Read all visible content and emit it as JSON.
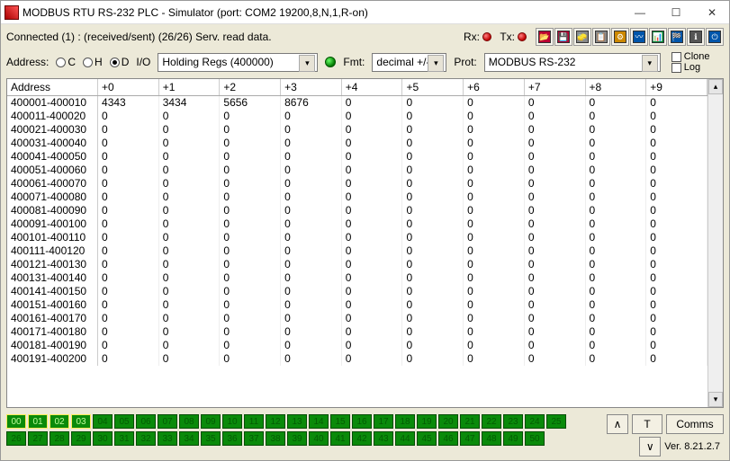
{
  "title": "MODBUS RTU RS-232 PLC - Simulator (port: COM2 19200,8,N,1,R-on)",
  "status": "Connected (1) : (received/sent) (26/26) Serv. read data.",
  "rx_label": "Rx:",
  "tx_label": "Tx:",
  "address_label": "Address:",
  "radio_c": "C",
  "radio_h": "H",
  "radio_d_checked": "D",
  "io_label": "I/O",
  "reg_sel": "Holding Regs (400000)",
  "fmt_label": "Fmt:",
  "fmt_sel": "decimal +/-",
  "prot_label": "Prot:",
  "prot_sel": "MODBUS RS-232",
  "clone_label": "Clone",
  "log_label": "Log",
  "icon_names": [
    "open",
    "save",
    "erase",
    "copy",
    "config",
    "wave",
    "chart",
    "flag",
    "about",
    "exit"
  ],
  "columns": [
    "Address",
    "+0",
    "+1",
    "+2",
    "+3",
    "+4",
    "+5",
    "+6",
    "+7",
    "+8",
    "+9"
  ],
  "rows": [
    {
      "addr": "400001-400010",
      "v": [
        "4343",
        "3434",
        "5656",
        "8676",
        "0",
        "0",
        "0",
        "0",
        "0",
        "0"
      ]
    },
    {
      "addr": "400011-400020",
      "v": [
        "0",
        "0",
        "0",
        "0",
        "0",
        "0",
        "0",
        "0",
        "0",
        "0"
      ]
    },
    {
      "addr": "400021-400030",
      "v": [
        "0",
        "0",
        "0",
        "0",
        "0",
        "0",
        "0",
        "0",
        "0",
        "0"
      ]
    },
    {
      "addr": "400031-400040",
      "v": [
        "0",
        "0",
        "0",
        "0",
        "0",
        "0",
        "0",
        "0",
        "0",
        "0"
      ]
    },
    {
      "addr": "400041-400050",
      "v": [
        "0",
        "0",
        "0",
        "0",
        "0",
        "0",
        "0",
        "0",
        "0",
        "0"
      ]
    },
    {
      "addr": "400051-400060",
      "v": [
        "0",
        "0",
        "0",
        "0",
        "0",
        "0",
        "0",
        "0",
        "0",
        "0"
      ]
    },
    {
      "addr": "400061-400070",
      "v": [
        "0",
        "0",
        "0",
        "0",
        "0",
        "0",
        "0",
        "0",
        "0",
        "0"
      ]
    },
    {
      "addr": "400071-400080",
      "v": [
        "0",
        "0",
        "0",
        "0",
        "0",
        "0",
        "0",
        "0",
        "0",
        "0"
      ]
    },
    {
      "addr": "400081-400090",
      "v": [
        "0",
        "0",
        "0",
        "0",
        "0",
        "0",
        "0",
        "0",
        "0",
        "0"
      ]
    },
    {
      "addr": "400091-400100",
      "v": [
        "0",
        "0",
        "0",
        "0",
        "0",
        "0",
        "0",
        "0",
        "0",
        "0"
      ]
    },
    {
      "addr": "400101-400110",
      "v": [
        "0",
        "0",
        "0",
        "0",
        "0",
        "0",
        "0",
        "0",
        "0",
        "0"
      ]
    },
    {
      "addr": "400111-400120",
      "v": [
        "0",
        "0",
        "0",
        "0",
        "0",
        "0",
        "0",
        "0",
        "0",
        "0"
      ]
    },
    {
      "addr": "400121-400130",
      "v": [
        "0",
        "0",
        "0",
        "0",
        "0",
        "0",
        "0",
        "0",
        "0",
        "0"
      ]
    },
    {
      "addr": "400131-400140",
      "v": [
        "0",
        "0",
        "0",
        "0",
        "0",
        "0",
        "0",
        "0",
        "0",
        "0"
      ]
    },
    {
      "addr": "400141-400150",
      "v": [
        "0",
        "0",
        "0",
        "0",
        "0",
        "0",
        "0",
        "0",
        "0",
        "0"
      ]
    },
    {
      "addr": "400151-400160",
      "v": [
        "0",
        "0",
        "0",
        "0",
        "0",
        "0",
        "0",
        "0",
        "0",
        "0"
      ]
    },
    {
      "addr": "400161-400170",
      "v": [
        "0",
        "0",
        "0",
        "0",
        "0",
        "0",
        "0",
        "0",
        "0",
        "0"
      ]
    },
    {
      "addr": "400171-400180",
      "v": [
        "0",
        "0",
        "0",
        "0",
        "0",
        "0",
        "0",
        "0",
        "0",
        "0"
      ]
    },
    {
      "addr": "400181-400190",
      "v": [
        "0",
        "0",
        "0",
        "0",
        "0",
        "0",
        "0",
        "0",
        "0",
        "0"
      ]
    },
    {
      "addr": "400191-400200",
      "v": [
        "0",
        "0",
        "0",
        "0",
        "0",
        "0",
        "0",
        "0",
        "0",
        "0"
      ]
    }
  ],
  "nodes_row1": [
    "00",
    "01",
    "02",
    "03",
    "04",
    "05",
    "06",
    "07",
    "08",
    "09",
    "10",
    "11",
    "12",
    "13",
    "14",
    "15",
    "16",
    "17",
    "18",
    "19",
    "20",
    "21",
    "22",
    "23",
    "24",
    "25"
  ],
  "nodes_row2": [
    "26",
    "27",
    "28",
    "29",
    "30",
    "31",
    "32",
    "33",
    "34",
    "35",
    "36",
    "37",
    "38",
    "39",
    "40",
    "41",
    "42",
    "43",
    "44",
    "45",
    "46",
    "47",
    "48",
    "49",
    "50"
  ],
  "nodes_active": [
    "00",
    "01",
    "02",
    "03"
  ],
  "btn_up": "∧",
  "btn_down": "∨",
  "btn_t": "T",
  "btn_comms": "Comms",
  "version": "Ver. 8.21.2.7"
}
